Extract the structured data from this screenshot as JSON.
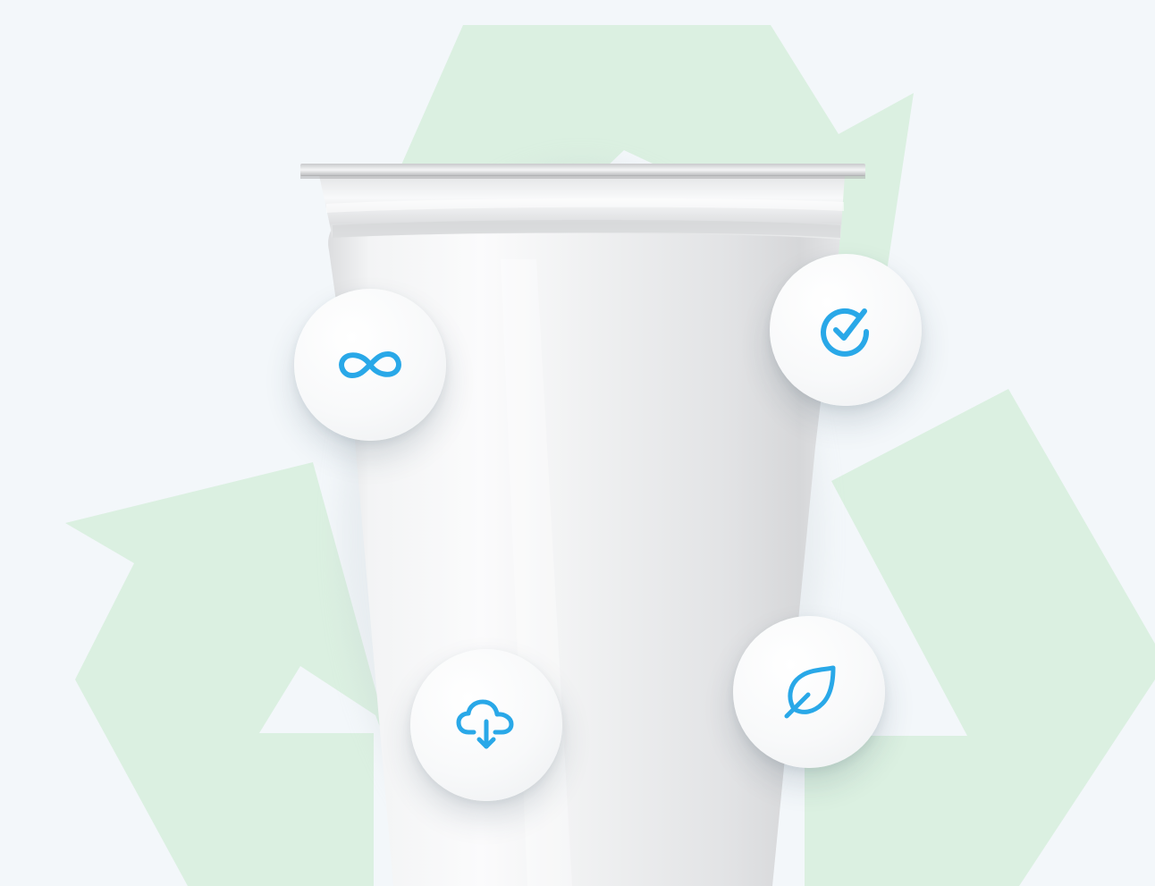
{
  "colors": {
    "background": "#f3f7fa",
    "recycle_symbol": "#dbf0e1",
    "icon_accent": "#29a8e8",
    "cup": "#f1f2f3"
  },
  "illustration": {
    "background_symbol": "recycle-symbol",
    "subject": "white-plastic-cup-with-foil-lid"
  },
  "features": [
    {
      "id": "infinite",
      "icon": "infinity-icon"
    },
    {
      "id": "certified",
      "icon": "check-circle-icon"
    },
    {
      "id": "download",
      "icon": "cloud-download-icon"
    },
    {
      "id": "eco",
      "icon": "leaf-icon"
    }
  ]
}
